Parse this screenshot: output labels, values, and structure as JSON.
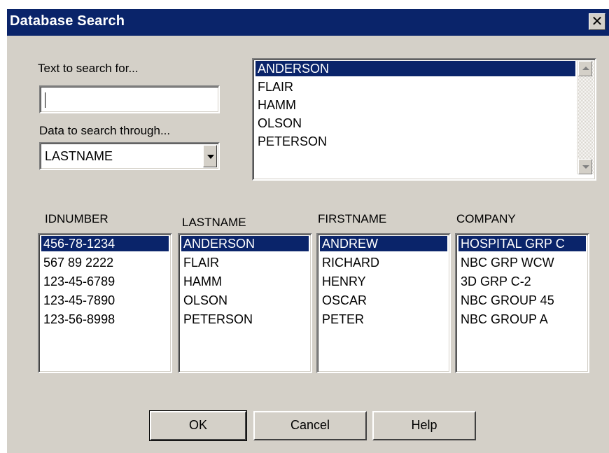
{
  "window": {
    "title": "Database Search"
  },
  "search": {
    "text_label": "Text to search for...",
    "text_value": "",
    "data_label": "Data to search through...",
    "data_value": "LASTNAME"
  },
  "results": {
    "selected_index": 0,
    "items": [
      "ANDERSON",
      "FLAIR",
      "HAMM",
      "OLSON",
      "PETERSON"
    ]
  },
  "columns": [
    {
      "header": "IDNUMBER",
      "selected_index": 0,
      "items": [
        "456-78-1234",
        "567 89 2222",
        "123-45-6789",
        "123-45-7890",
        "123-56-8998"
      ]
    },
    {
      "header": "LASTNAME",
      "selected_index": 0,
      "items": [
        "ANDERSON",
        "FLAIR",
        "HAMM",
        "OLSON",
        "PETERSON"
      ]
    },
    {
      "header": "FIRSTNAME",
      "selected_index": 0,
      "items": [
        "ANDREW",
        "RICHARD",
        "HENRY",
        "OSCAR",
        "PETER"
      ]
    },
    {
      "header": "COMPANY",
      "selected_index": 0,
      "items": [
        "HOSPITAL GRP C",
        "NBC GRP WCW",
        "3D GRP C-2",
        "NBC GROUP 45",
        "NBC GROUP A"
      ]
    }
  ],
  "buttons": {
    "ok": "OK",
    "cancel": "Cancel",
    "help": "Help"
  },
  "icons": {
    "close": "close-icon",
    "dropdown": "chevron-down-icon"
  },
  "colors": {
    "title_bar": "#0a246a",
    "selection": "#0a246a",
    "face": "#d4d0c8"
  }
}
